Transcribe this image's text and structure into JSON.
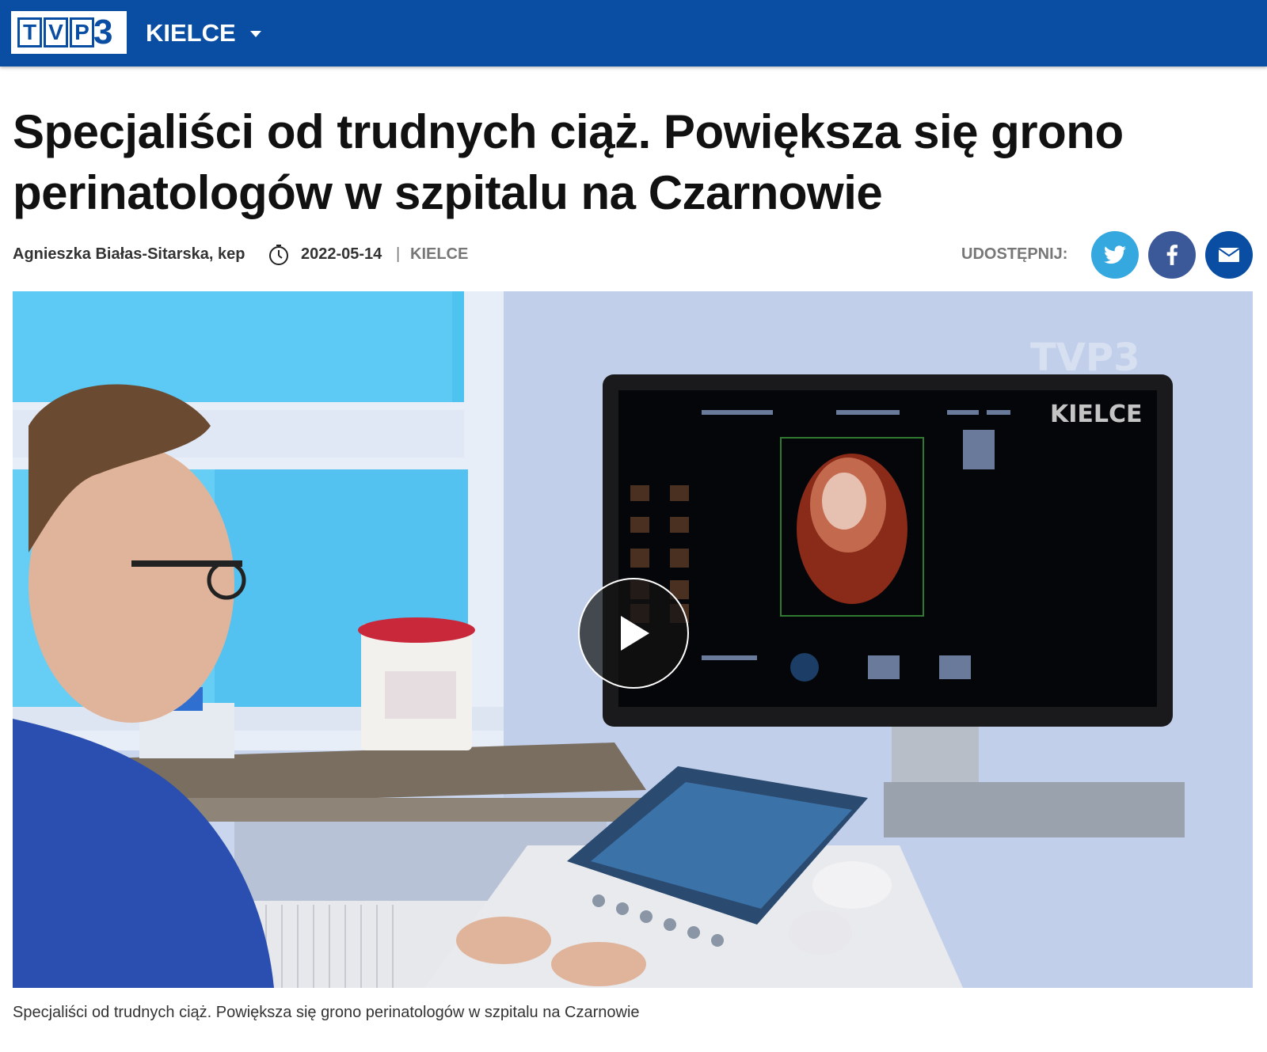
{
  "header": {
    "logo_letters": [
      "T",
      "V",
      "P"
    ],
    "logo_number": "3",
    "region": "KIELCE"
  },
  "article": {
    "title": "Specjaliści od trudnych ciąż. Powiększa się grono perinatologów w szpitalu na Czarnowie",
    "author": "Agnieszka Białas-Sitarska, kep",
    "date": "2022-05-14",
    "separator": "|",
    "region": "KIELCE",
    "share_label": "UDOSTĘPNIJ:",
    "share_buttons": [
      {
        "name": "twitter",
        "icon": "twitter-icon",
        "color": "#35a8e0"
      },
      {
        "name": "facebook",
        "icon": "facebook-icon",
        "color": "#3b5998"
      },
      {
        "name": "email",
        "icon": "email-icon",
        "color": "#0a4ea3"
      }
    ],
    "video": {
      "watermark_logo": "TVP3",
      "watermark_region": "KIELCE",
      "play_icon": "play-icon"
    },
    "caption": "Specjaliści od trudnych ciąż. Powiększa się grono perinatologów w szpitalu na Czarnowie"
  },
  "colors": {
    "brand_blue": "#0a4ea3",
    "twitter": "#35a8e0",
    "facebook": "#3b5998"
  }
}
